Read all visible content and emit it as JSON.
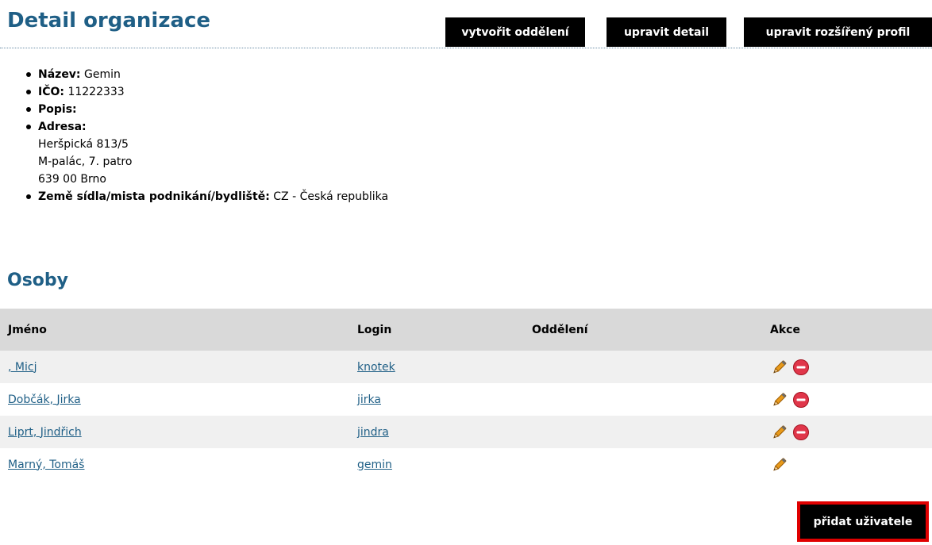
{
  "header": {
    "title": "Detail organizace",
    "buttons": {
      "create_department": "vytvořit oddělení",
      "edit_detail": "upravit detail",
      "edit_extended_profile": "upravit rozšířený profil"
    }
  },
  "info": {
    "name_label": "Název:",
    "name_value": "Gemin",
    "ico_label": "IČO:",
    "ico_value": "11222333",
    "description_label": "Popis:",
    "address_label": "Adresa:",
    "address_lines": [
      "Heršpická 813/5",
      "M-palác, 7. patro",
      "639 00 Brno"
    ],
    "country_label": "Země sídla/mista podnikání/bydliště:",
    "country_value": "CZ - Česká republika"
  },
  "persons": {
    "title": "Osoby",
    "columns": {
      "name": "Jméno",
      "login": "Login",
      "department": "Oddělení",
      "actions": "Akce"
    },
    "rows": [
      {
        "name": ", Micj",
        "login": "knotek",
        "department": "",
        "can_delete": true
      },
      {
        "name": "Dobčák, Jirka",
        "login": "jirka",
        "department": "",
        "can_delete": true
      },
      {
        "name": "Liprt, Jindřich",
        "login": "jindra",
        "department": "",
        "can_delete": true
      },
      {
        "name": "Marný, Tomáš",
        "login": "gemin",
        "department": "",
        "can_delete": false
      }
    ],
    "icons": {
      "edit": "pencil-icon",
      "delete": "delete-icon"
    }
  },
  "footer": {
    "add_user_label": "přidat uživatele"
  },
  "colors": {
    "heading": "#1f5f86",
    "link": "#1f5f86",
    "button_bg": "#000000",
    "highlight": "#e00000",
    "delete_icon": "#e0364a",
    "pencil_icon": "#e89a1a"
  }
}
